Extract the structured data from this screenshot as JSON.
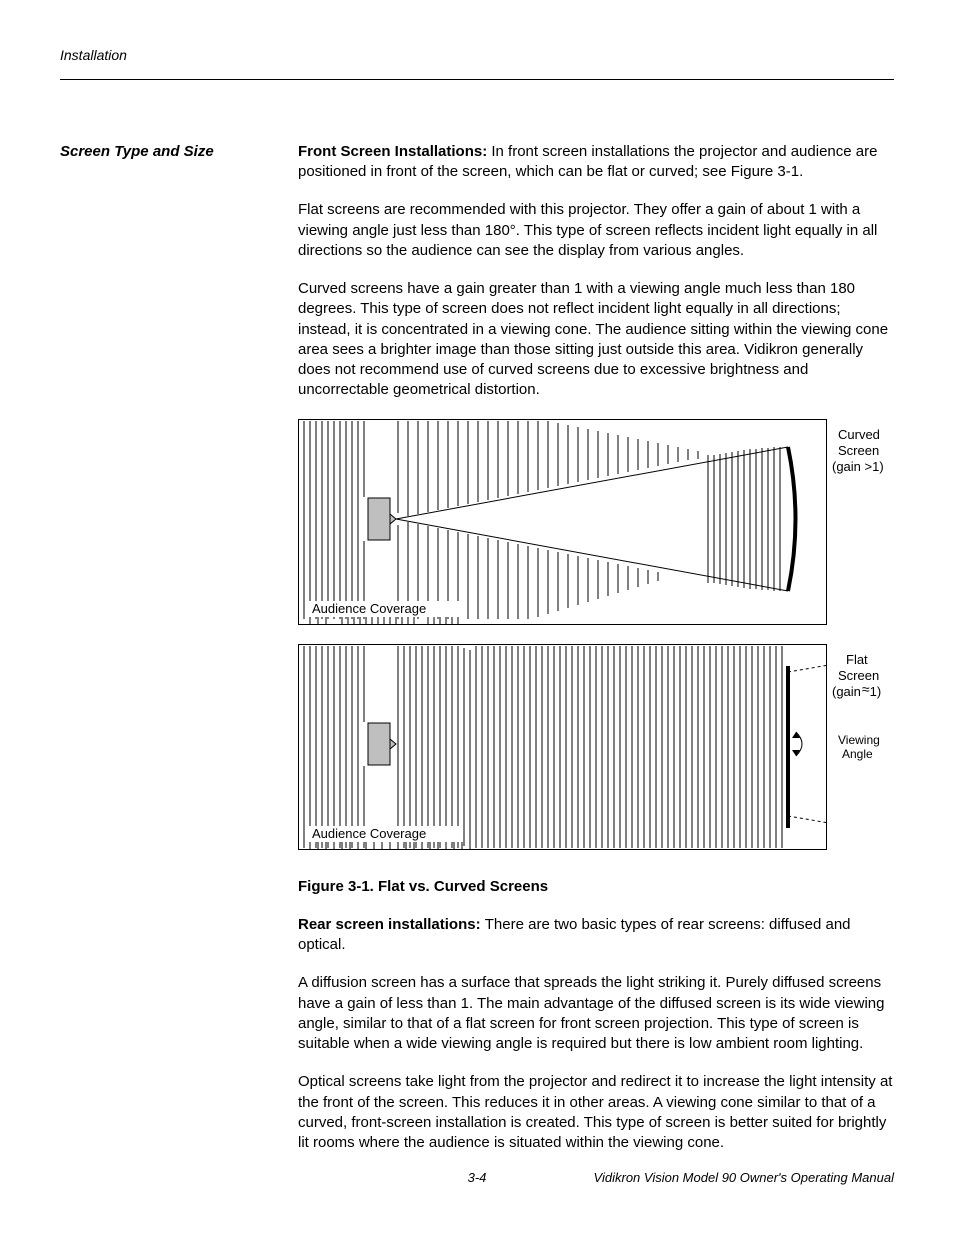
{
  "header": {
    "section": "Installation"
  },
  "side": {
    "heading": "Screen Type and Size"
  },
  "body": {
    "p1_lead": "Front Screen Installations: ",
    "p1": "In front screen installations the projector and audience are positioned in front of the screen, which can be flat or curved; see Figure 3-1.",
    "p2": "Flat screens are recommended with this projector. They offer a gain of about 1 with a viewing angle just less than 180°. This type of screen reflects incident light equally in all directions so the audience can see the display from various angles.",
    "p3": "Curved screens have a gain greater than 1 with a viewing angle much less than 180 degrees. This type of screen does not reflect incident light equally in all directions; instead, it is concentrated in a viewing cone. The audience sitting within the viewing cone area sees a brighter image than those sitting just outside this area. Vidikron generally does not recommend use of curved screens due to excessive brightness and uncorrectable geometrical distortion.",
    "fig_top_label1": "Curved",
    "fig_top_label2": "Screen",
    "fig_top_label3": "(gain >1)",
    "fig_audience": "Audience Coverage",
    "fig_bot_label1": "Flat",
    "fig_bot_label2": "Screen",
    "fig_bot_gain_prefix": "(gain",
    "fig_bot_gain_suffix": "1)",
    "fig_viewing1": "Viewing",
    "fig_viewing2": "Angle",
    "caption": "Figure 3-1. Flat vs. Curved Screens",
    "p4_lead": "Rear screen installations: ",
    "p4": "There are two basic types of rear screens: diffused and optical.",
    "p5": "A diffusion screen has a surface that spreads the light striking it. Purely diffused screens have a gain of less than 1. The main advantage of the diffused screen is its wide viewing angle, similar to that of a flat screen for front screen projection. This type of screen is suitable when a wide viewing angle is required but there is low ambient room lighting.",
    "p6": "Optical screens take light from the projector and redirect it to increase the light intensity at the front of the screen. This reduces it in other areas. A viewing cone similar to that of a curved, front-screen installation is created. This type of screen is better suited for brightly lit rooms where the audience is situated within the viewing cone."
  },
  "footer": {
    "page": "3-4",
    "doc": "Vidikron Vision Model 90 Owner's Operating Manual"
  }
}
